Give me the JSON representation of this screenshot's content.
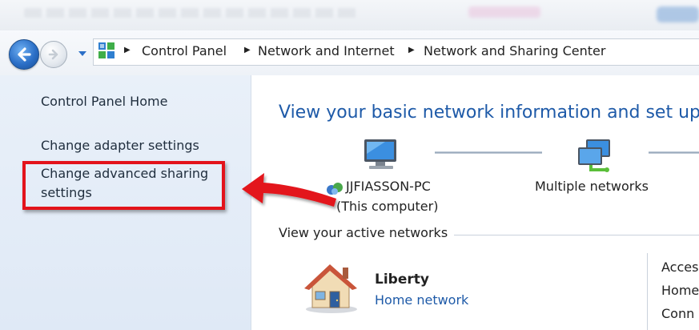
{
  "breadcrumb": {
    "items": [
      "Control Panel",
      "Network and Internet",
      "Network and Sharing Center"
    ]
  },
  "sidebar": {
    "items": [
      {
        "label": "Control Panel Home"
      },
      {
        "label": "Change adapter settings"
      },
      {
        "label": "Change advanced sharing"
      },
      {
        "label": "settings"
      }
    ]
  },
  "main": {
    "title": "View your basic network information and set up c",
    "computer": {
      "name": "JJFIASSON-PC",
      "subtitle": "(This computer)"
    },
    "networks": {
      "label": "Multiple networks"
    },
    "active_section": {
      "label": "View your active networks"
    },
    "active_network": {
      "name": "Liberty",
      "type": "Home network"
    },
    "right_labels": [
      "Acces",
      "Home",
      "Conn"
    ]
  },
  "colors": {
    "annotation": "#e3131b",
    "link": "#1e5aa8"
  }
}
